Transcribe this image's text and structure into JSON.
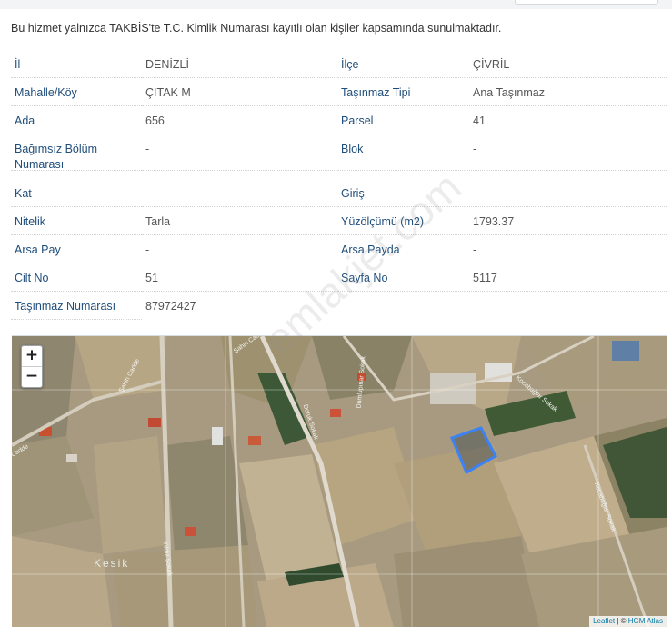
{
  "notice": "Bu hizmet yalnızca TAKBİS'te T.C. Kimlik Numarası kayıtlı olan kişiler kapsamında sunulmaktadır.",
  "fields": {
    "il": {
      "label": "İl",
      "value": "DENİZLİ"
    },
    "ilce": {
      "label": "İlçe",
      "value": "ÇİVRİL"
    },
    "mahalle": {
      "label": "Mahalle/Köy",
      "value": "ÇITAK M"
    },
    "tasinmaz_tipi": {
      "label": "Taşınmaz Tipi",
      "value": "Ana Taşınmaz"
    },
    "ada": {
      "label": "Ada",
      "value": "656"
    },
    "parsel": {
      "label": "Parsel",
      "value": "41"
    },
    "bagimsiz_bolum": {
      "label": "Bağımsız Bölüm Numarası",
      "value": "-"
    },
    "blok": {
      "label": "Blok",
      "value": "-"
    },
    "kat": {
      "label": "Kat",
      "value": "-"
    },
    "giris": {
      "label": "Giriş",
      "value": "-"
    },
    "nitelik": {
      "label": "Nitelik",
      "value": "Tarla"
    },
    "yuzolcumu": {
      "label": "Yüzölçümü (m2)",
      "value": "1793.37"
    },
    "arsa_pay": {
      "label": "Arsa Pay",
      "value": "-"
    },
    "arsa_payda": {
      "label": "Arsa Payda",
      "value": "-"
    },
    "cilt_no": {
      "label": "Cilt No",
      "value": "51"
    },
    "sayfa_no": {
      "label": "Sayfa No",
      "value": "5117"
    },
    "tasinmaz_numarasi": {
      "label": "Taşınmaz Numarası",
      "value": "87972427"
    }
  },
  "map": {
    "zoom_in": "+",
    "zoom_out": "−",
    "attribution_leaflet": "Leaflet",
    "attribution_sep": " | © ",
    "attribution_source": "HGM Atlas",
    "place_label": "Kesik",
    "street_labels": [
      "Şahin Cadde",
      "Şahin Cad",
      "Dumlupınar Sokak",
      "Kocabağlar Sokak",
      "Kocabağlar Sokak",
      "Doruk Sokak",
      "Yıldız Sokak",
      "Cadde"
    ],
    "parcel_color": "#3b82f6"
  },
  "watermark": "emlakjet.com"
}
